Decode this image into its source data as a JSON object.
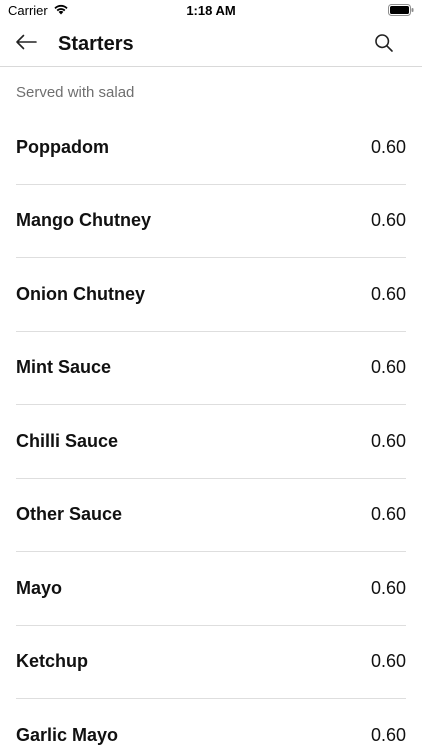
{
  "status_bar": {
    "carrier": "Carrier",
    "time": "1:18 AM",
    "icons": [
      "wifi-icon",
      "battery-icon"
    ]
  },
  "nav": {
    "title": "Starters",
    "back_icon": "arrow-left-icon",
    "search_icon": "search-icon"
  },
  "section": {
    "subtitle": "Served with salad"
  },
  "menu_items": [
    {
      "name": "Poppadom",
      "price": "0.60"
    },
    {
      "name": "Mango Chutney",
      "price": "0.60"
    },
    {
      "name": "Onion Chutney",
      "price": "0.60"
    },
    {
      "name": "Mint Sauce",
      "price": "0.60"
    },
    {
      "name": "Chilli Sauce",
      "price": "0.60"
    },
    {
      "name": "Other Sauce",
      "price": "0.60"
    },
    {
      "name": "Mayo",
      "price": "0.60"
    },
    {
      "name": "Ketchup",
      "price": "0.60"
    },
    {
      "name": "Garlic Mayo",
      "price": "0.60"
    }
  ],
  "colors": {
    "text": "#111111",
    "subtitle": "#6f6f6f",
    "divider": "#dedede",
    "background": "#ffffff"
  }
}
